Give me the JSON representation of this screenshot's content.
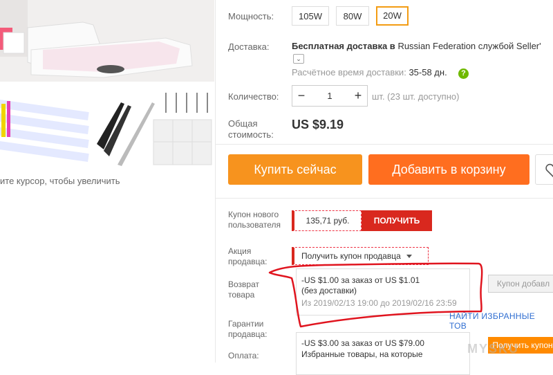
{
  "gallery": {
    "zoom_hint": "ите курсор, чтобы увеличить"
  },
  "power": {
    "label": "Мощность:",
    "options": [
      "105W",
      "80W",
      "20W"
    ],
    "selected": "20W"
  },
  "delivery": {
    "label": "Доставка:",
    "text_bold": "Бесплатная доставка в",
    "text_country": "Russian Federation службой Seller'",
    "time_label": "Расчётное время доставки:",
    "time_value": "35-58 дн."
  },
  "quantity": {
    "label": "Количество:",
    "value": "1",
    "available": "шт. (23 шт. доступно)"
  },
  "total": {
    "label_line1": "Общая",
    "label_line2": "стоимость:",
    "value": "US $9.19"
  },
  "actions": {
    "buy_now": "Купить сейчас",
    "add_to_cart": "Добавить в корзину"
  },
  "new_user_coupon": {
    "label_line1": "Купон нового",
    "label_line2": "пользователя",
    "amount": "135,71 руб.",
    "button": "ПОЛУЧИТЬ"
  },
  "seller_promo": {
    "label_line1": "Акция",
    "label_line2": "продавца:",
    "dropdown": "Получить купон продавца",
    "coupon1": {
      "line1": "-US $1.00 за заказ от US $1.01",
      "line2": "(без доставки)",
      "validity": "Из 2019/02/13 19:00 до 2019/02/16 23:59",
      "button": "Купон добавл"
    },
    "coupon2": {
      "line1": "-US $3.00 за заказ от US $79.00",
      "line2": "Избранные товары, на которые",
      "button": "Получить купон"
    },
    "featured_link": "НАЙТИ ИЗБРАННЫЕ ТОВ"
  },
  "returns": {
    "label_line1": "Возврат",
    "label_line2": "товара"
  },
  "guarantees": {
    "label_line1": "Гарантии",
    "label_line2": "продавца:"
  },
  "payment": {
    "label": "Оплата:"
  },
  "watermark": "MYSKU",
  "colors": {
    "accent_orange": "#f7931e",
    "cart_orange": "#ff6e1f",
    "coupon_red": "#d9281e",
    "annotation_red": "#e0141e",
    "selected_border": "#f39c12"
  }
}
